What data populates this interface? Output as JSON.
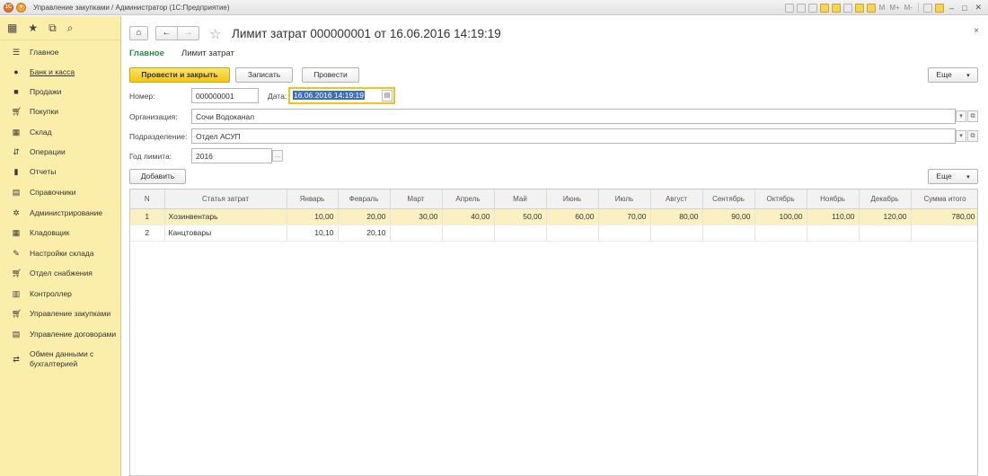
{
  "window": {
    "title": "Управление закупками / Администратор  (1С:Предприятие)",
    "toolbar_texts": [
      "M",
      "M+",
      "M-"
    ]
  },
  "sidebar": {
    "items": [
      {
        "label": "Главное",
        "icon": "list-icon",
        "link": false
      },
      {
        "label": "Банк и касса",
        "icon": "bank-icon",
        "link": true
      },
      {
        "label": "Продажи",
        "icon": "bag-icon",
        "link": false
      },
      {
        "label": "Покупки",
        "icon": "cart-icon",
        "link": false
      },
      {
        "label": "Склад",
        "icon": "warehouse-icon",
        "link": false
      },
      {
        "label": "Операции",
        "icon": "operations-icon",
        "link": false
      },
      {
        "label": "Отчеты",
        "icon": "chart-icon",
        "link": false
      },
      {
        "label": "Справочники",
        "icon": "book-icon",
        "link": false
      },
      {
        "label": "Администрирование",
        "icon": "gear-icon",
        "link": false
      },
      {
        "label": "Кладовщик",
        "icon": "warehouse-icon",
        "link": false
      },
      {
        "label": "Настройки склада",
        "icon": "wrench-icon",
        "link": false
      },
      {
        "label": "Отдел снабжения",
        "icon": "cart-icon",
        "link": false
      },
      {
        "label": "Контроллер",
        "icon": "calculator-icon",
        "link": false
      },
      {
        "label": "Управление закупками",
        "icon": "cart-plus-icon",
        "link": false
      },
      {
        "label": "Управление договорами",
        "icon": "document-icon",
        "link": false
      },
      {
        "label": "Обмен данными с бухгалтерией",
        "icon": "exchange-icon",
        "link": false
      }
    ]
  },
  "doc": {
    "title": "Лимит затрат 000000001 от 16.06.2016 14:19:19",
    "tabs": [
      "Главное",
      "Лимит затрат"
    ]
  },
  "actions": {
    "post_close": "Провести и закрыть",
    "save": "Записать",
    "post": "Провести",
    "more": "Еще",
    "add": "Добавить"
  },
  "form": {
    "number_label": "Номер:",
    "number": "000000001",
    "date_label": "Дата:",
    "date": "16.06.2016 14:19:19",
    "org_label": "Организация:",
    "org": "Сочи Водоканал",
    "dept_label": "Подразделение:",
    "dept": "Отдел АСУП",
    "year_label": "Год лимита:",
    "year": "2016"
  },
  "table": {
    "columns": [
      "N",
      "Статья затрат",
      "Январь",
      "Февраль",
      "Март",
      "Апрель",
      "Май",
      "Июнь",
      "Июль",
      "Август",
      "Сентябрь",
      "Октябрь",
      "Ноябрь",
      "Декабрь",
      "Сумма итого"
    ],
    "rows": [
      [
        "1",
        "Хозинвентарь",
        "10,00",
        "20,00",
        "30,00",
        "40,00",
        "50,00",
        "60,00",
        "70,00",
        "80,00",
        "90,00",
        "100,00",
        "110,00",
        "120,00",
        "780,00"
      ],
      [
        "2",
        "Канцтовары",
        "10,10",
        "20,10",
        "",
        "",
        "",
        "",
        "",
        "",
        "",
        "",
        "",
        "",
        ""
      ]
    ]
  }
}
